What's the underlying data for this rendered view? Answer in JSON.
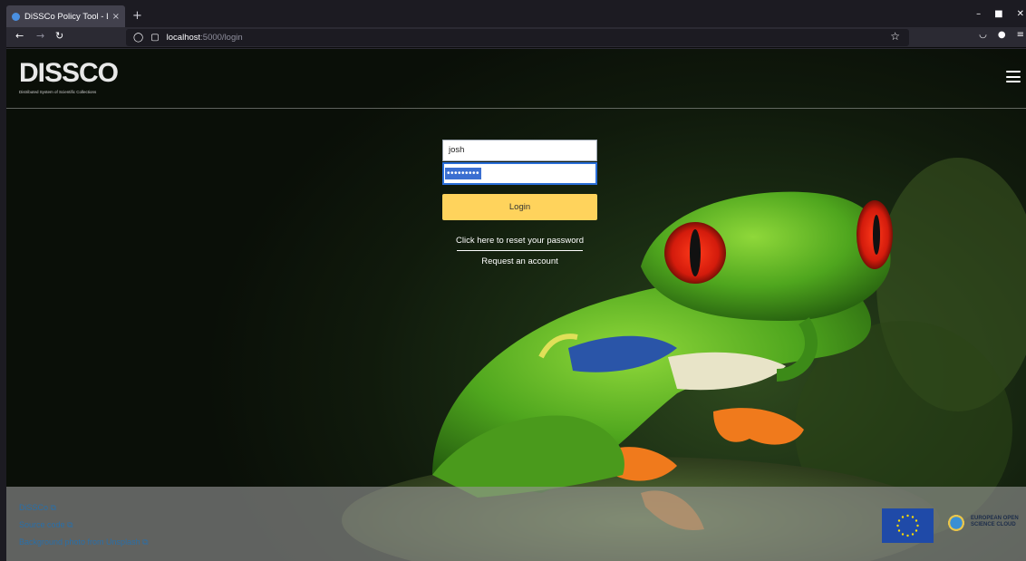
{
  "browser": {
    "tab_title": "DiSSCo Policy Tool - Login",
    "tab_close": "×",
    "new_tab": "+",
    "url_host": "localhost",
    "url_path": ":5000/login"
  },
  "header": {
    "logo_text": "DiSSCo",
    "logo_subtitle": "Distributed System of Scientific Collections"
  },
  "login": {
    "username_value": "josh",
    "password_mask": "•••••••••",
    "button_label": "Login",
    "reset_link": "Click here to reset your password",
    "request_link": "Request an account"
  },
  "footer": {
    "links": [
      {
        "label": "DiSSCo"
      },
      {
        "label": "Source code"
      },
      {
        "label": "Background photo from Unsplash"
      }
    ],
    "eosc_line1": "EUROPEAN OPEN",
    "eosc_line2": "SCIENCE CLOUD"
  },
  "colors": {
    "login_button": "#ffd35c",
    "link": "#2a6fa8",
    "focus_border": "#2a6ed8"
  },
  "icons": [
    "back-arrow-icon",
    "forward-arrow-icon",
    "reload-icon",
    "shield-icon",
    "page-icon",
    "star-icon",
    "pocket-icon",
    "account-icon",
    "menu-icon",
    "hamburger-icon",
    "external-link-icon"
  ]
}
